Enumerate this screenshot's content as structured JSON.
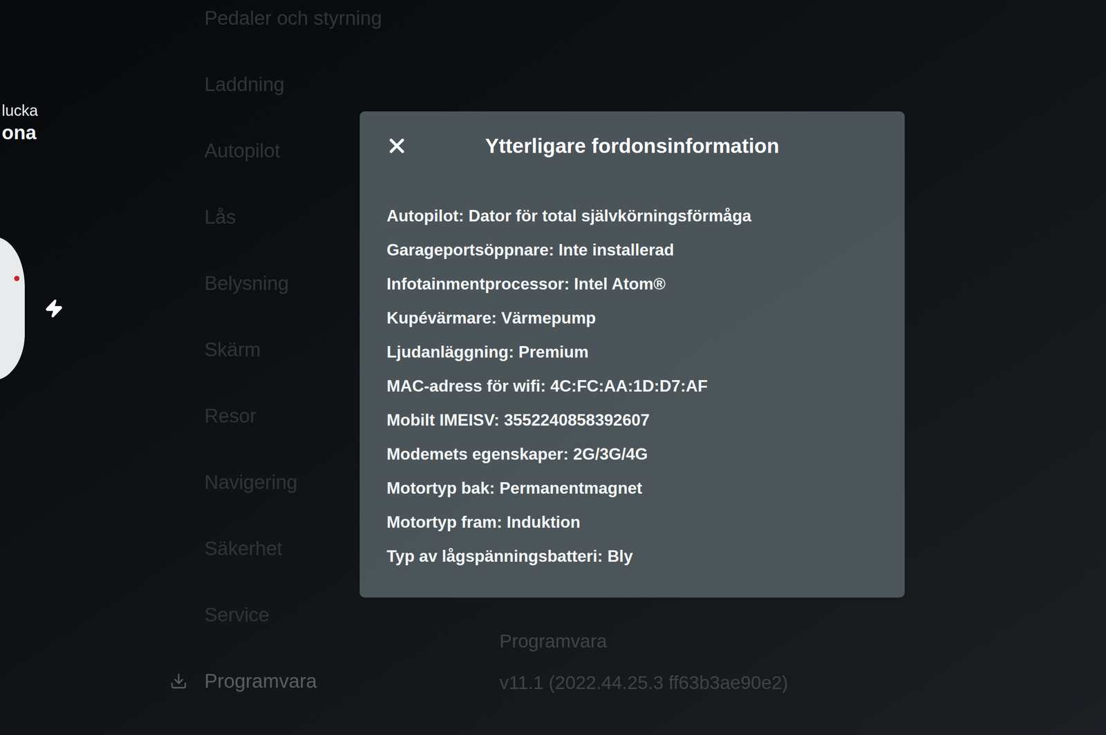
{
  "car_panel": {
    "lines": [
      "lucka",
      "ona"
    ]
  },
  "sidebar": {
    "items": [
      {
        "label": "Pedaler och styrning",
        "selected": false
      },
      {
        "label": "Laddning",
        "selected": false
      },
      {
        "label": "Autopilot",
        "selected": false
      },
      {
        "label": "Lås",
        "selected": false
      },
      {
        "label": "Belysning",
        "selected": false
      },
      {
        "label": "Skärm",
        "selected": false
      },
      {
        "label": "Resor",
        "selected": false
      },
      {
        "label": "Navigering",
        "selected": false
      },
      {
        "label": "Säkerhet",
        "selected": false
      },
      {
        "label": "Service",
        "selected": false
      },
      {
        "label": "Programvara",
        "selected": true
      }
    ]
  },
  "software": {
    "heading": "Programvara",
    "version": "v11.1 (2022.44.25.3 ff63b3ae90e2)"
  },
  "dialog": {
    "title": "Ytterligare fordonsinformation",
    "rows": [
      "Autopilot: Dator för total självkörningsförmåga",
      "Garageportsöppnare: Inte installerad",
      "Infotainmentprocessor: Intel Atom®",
      "Kupévärmare: Värmepump",
      "Ljudanläggning: Premium",
      "MAC-adress för wifi: 4C:FC:AA:1D:D7:AF",
      "Mobilt IMEISV: 3552240858392607",
      "Modemets egenskaper: 2G/3G/4G",
      "Motortyp bak: Permanentmagnet",
      "Motortyp fram: Induktion",
      "Typ av lågspänningsbatteri: Bly"
    ]
  }
}
